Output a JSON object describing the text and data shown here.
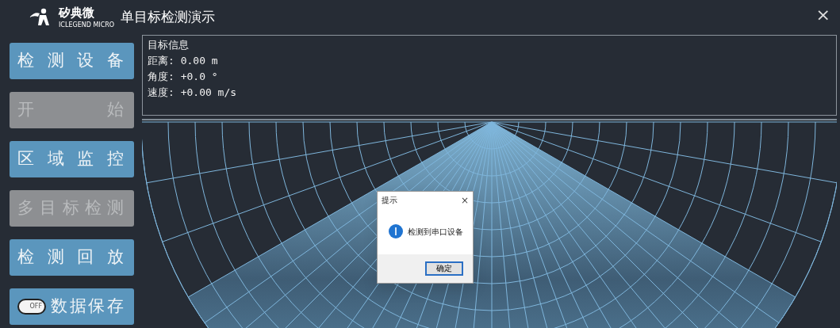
{
  "window": {
    "title": "单目标检测演示",
    "logo_name": "矽典微",
    "logo_subtitle": "ICLEGEND MICRO",
    "close": "×"
  },
  "buttons": [
    {
      "kind": "button",
      "label": "检测设备",
      "disabled": false
    },
    {
      "kind": "button",
      "label": "开始",
      "disabled": true
    },
    {
      "kind": "button",
      "label": "区域监控",
      "disabled": false
    },
    {
      "kind": "button",
      "label": "多目标检测",
      "disabled": true
    },
    {
      "kind": "button",
      "label": "检测回放",
      "disabled": false
    },
    {
      "kind": "toggle",
      "label": "数据保存",
      "disabled": false,
      "on": false,
      "switch_text": "OFF"
    }
  ],
  "info": {
    "title": "目标信息",
    "lines": [
      "距离: 0.00 m",
      "角度: +0.0 °",
      "速度: +0.00 m/s"
    ]
  },
  "dialog": {
    "title": "提示",
    "close": "×",
    "message": "检测到串口设备",
    "button": "确定"
  }
}
